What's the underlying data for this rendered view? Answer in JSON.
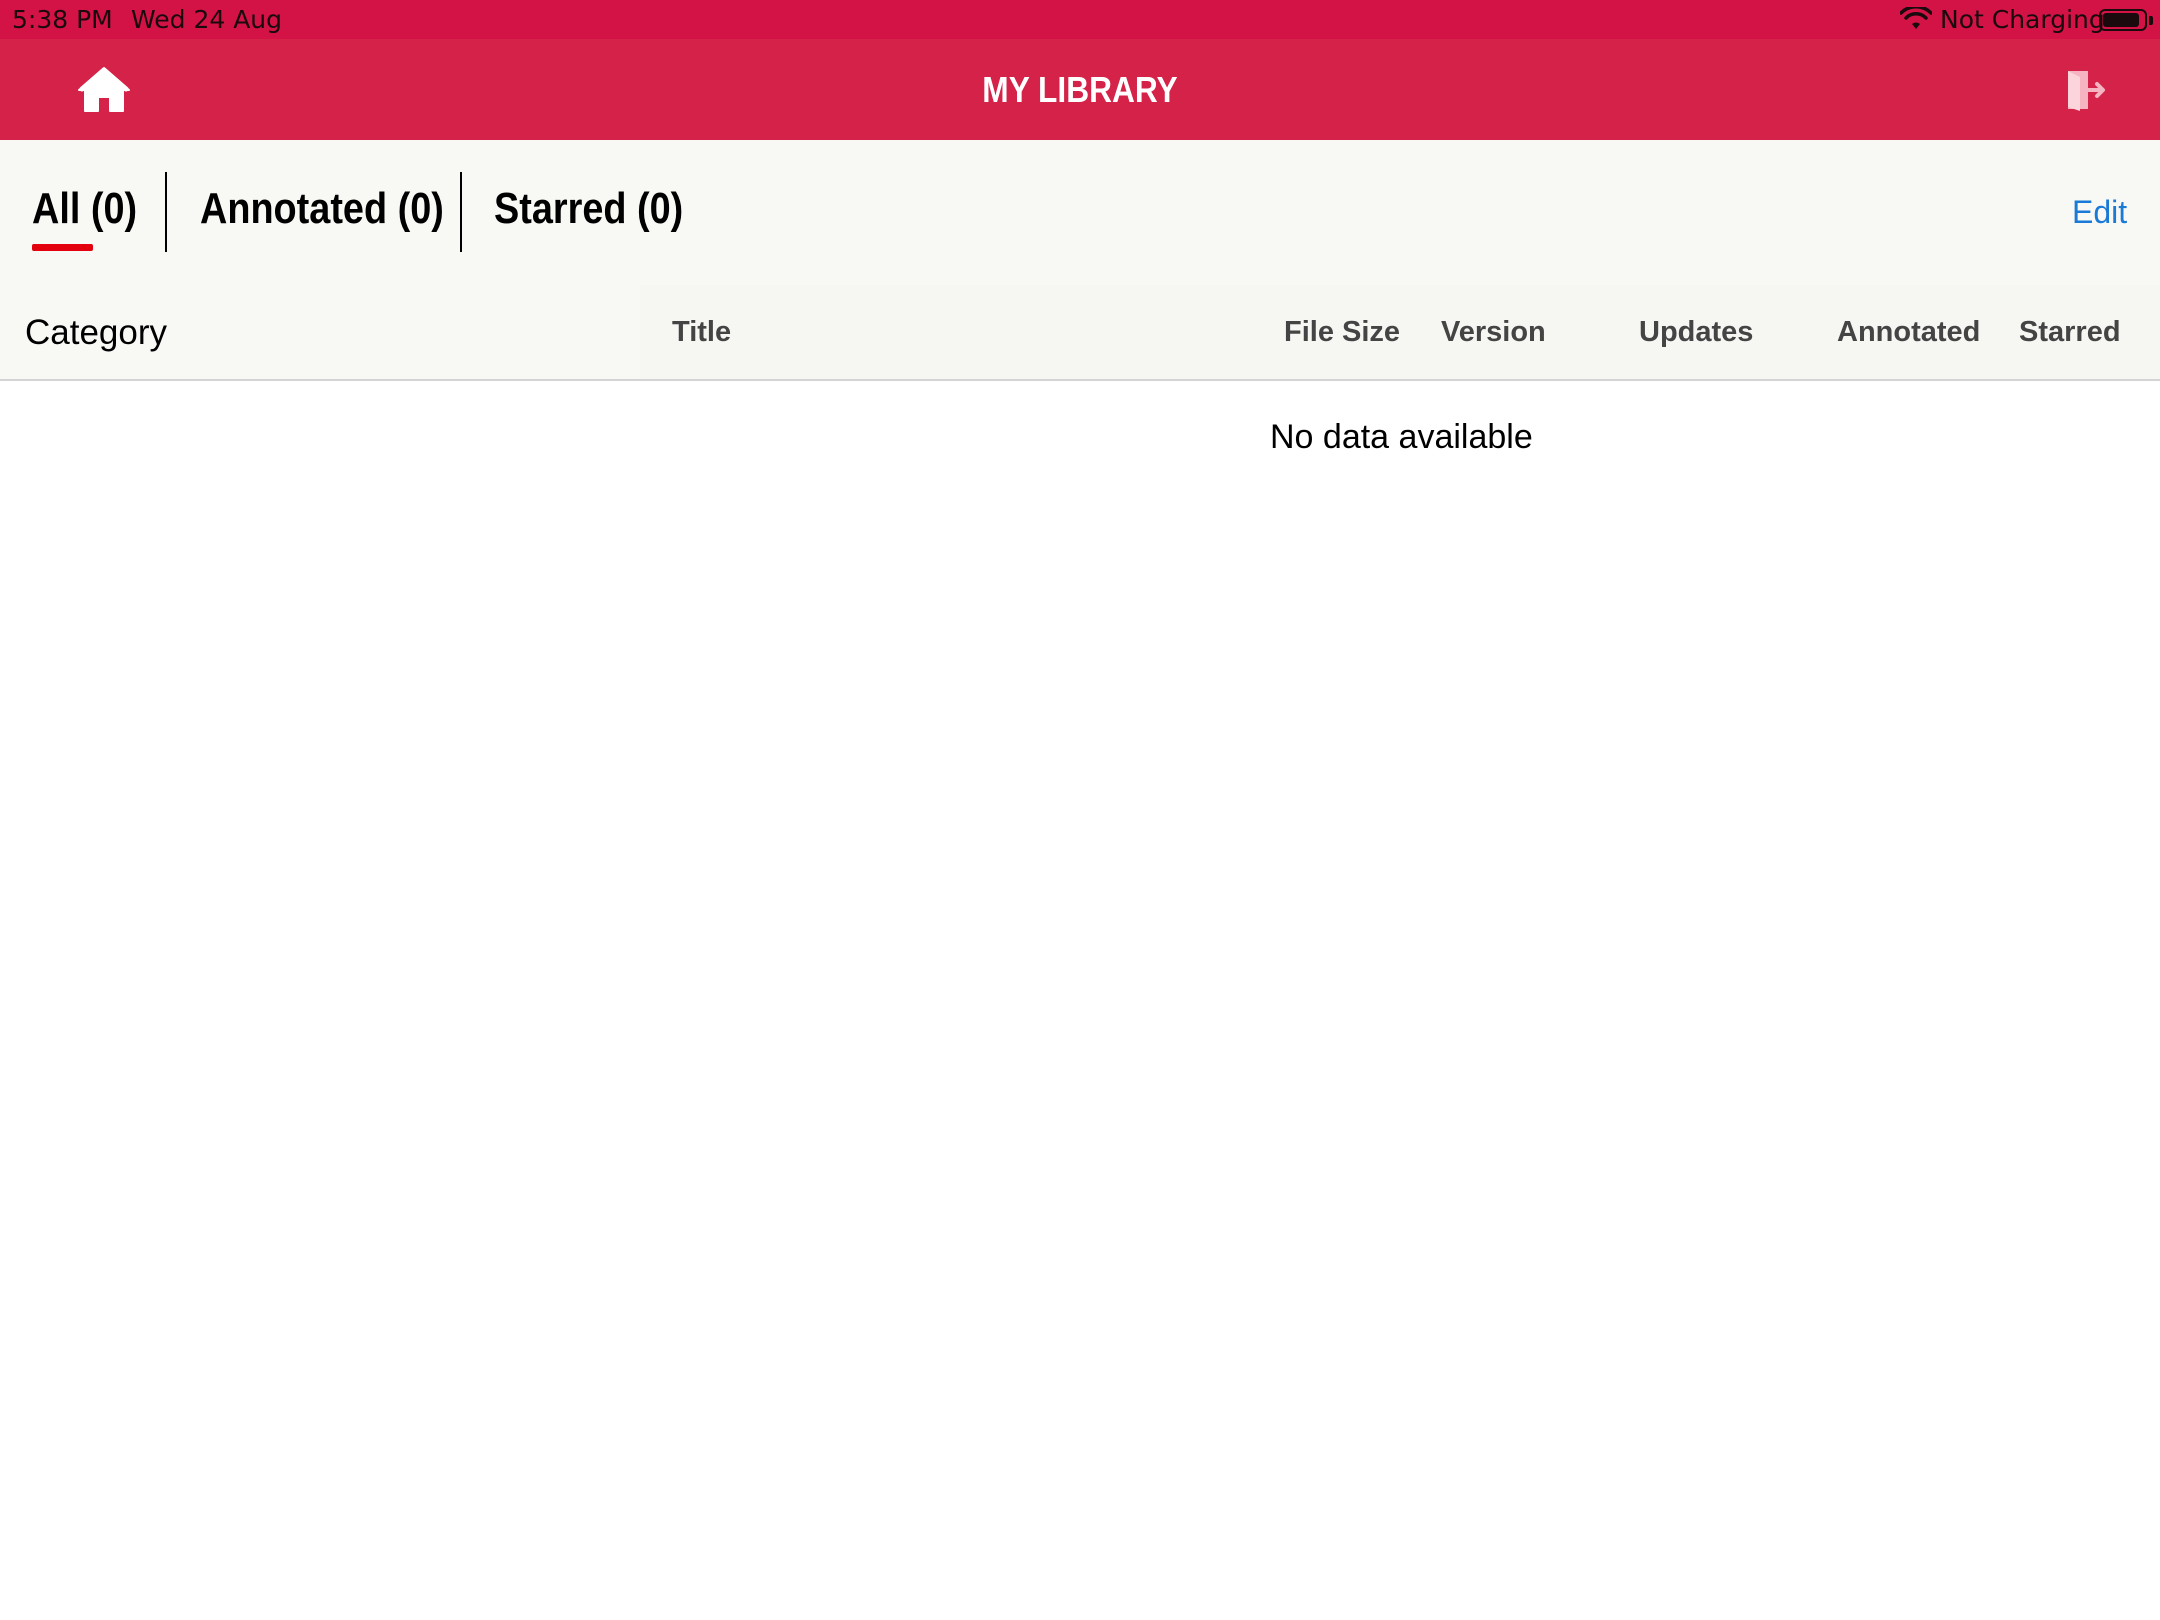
{
  "status_bar": {
    "time": "5:38 PM",
    "date": "Wed 24 Aug",
    "charging": "Not Charging",
    "wifi_icon": "wifi-icon",
    "battery_icon": "battery-icon"
  },
  "header": {
    "title": "MY LIBRARY",
    "home_icon": "home-icon",
    "logout_icon": "logout-icon",
    "background": "#d42248"
  },
  "tabs": [
    {
      "label": "All (0)",
      "active": true
    },
    {
      "label": "Annotated (0)",
      "active": false
    },
    {
      "label": "Starred (0)",
      "active": false
    }
  ],
  "edit_label": "Edit",
  "table": {
    "category_header": "Category",
    "columns": [
      "Title",
      "File Size",
      "Version",
      "Updates",
      "Annotated",
      "Starred"
    ],
    "empty_message": "No data available"
  },
  "colors": {
    "accent_red": "#e3000f",
    "link_blue": "#1a7ad6"
  }
}
